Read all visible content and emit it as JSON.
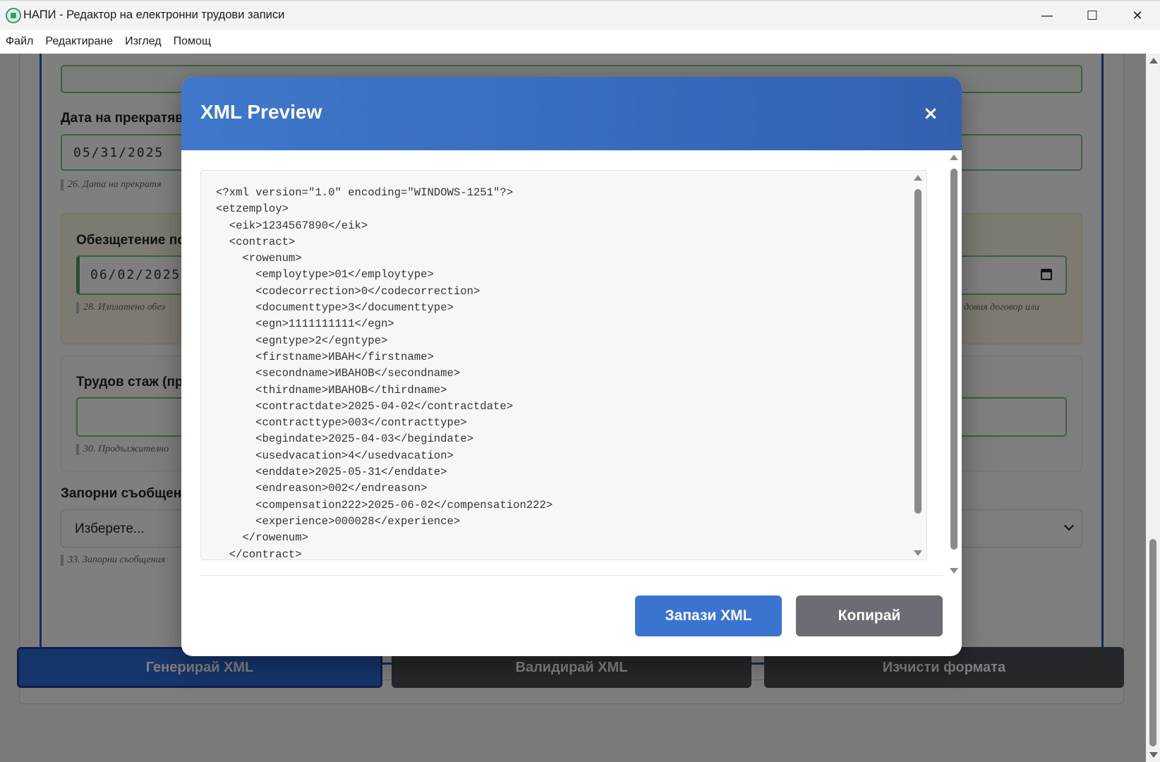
{
  "window": {
    "title": "НАПИ - Редактор на електронни трудови записи",
    "controls": {
      "minimize": "—",
      "maximize": "☐",
      "close": "✕"
    }
  },
  "menu": [
    "Файл",
    "Редактиране",
    "Изглед",
    "Помощ"
  ],
  "form": {
    "termination_date_label": "Дата на прекратяв",
    "termination_date_value": "05/31/2025",
    "termination_date_hint": "26. Дата на прекратя",
    "compensation_label": "Обезщетение по",
    "compensation_value": "06/02/2025",
    "compensation_hint": "28. Изплатено обез",
    "compensation_hint_right": "довия договор или",
    "experience_label": "Трудов стаж (пр",
    "experience_hint": "30. Продължително",
    "garnishment_label": "Запорни съобщени",
    "garnishment_value": "Изберете...",
    "garnishment_hint": "33. Запорни съобщения"
  },
  "bottom_buttons": {
    "generate": "Генерирай XML",
    "validate": "Валидирай XML",
    "clear": "Изчисти формата"
  },
  "modal": {
    "title": "XML Preview",
    "close": "×",
    "xml_lines": [
      "<?xml version=\"1.0\" encoding=\"WINDOWS-1251\"?>",
      "<etzemploy>",
      "  <eik>1234567890</eik>",
      "  <contract>",
      "    <rowenum>",
      "      <employtype>01</employtype>",
      "      <codecorrection>0</codecorrection>",
      "      <documenttype>3</documenttype>",
      "      <egn>1111111111</egn>",
      "      <egntype>2</egntype>",
      "      <firstname>ИВАН</firstname>",
      "      <secondname>ИВАНОВ</secondname>",
      "      <thirdname>ИВАНОВ</thirdname>",
      "      <contractdate>2025-04-02</contractdate>",
      "      <contracttype>003</contracttype>",
      "      <begindate>2025-04-03</begindate>",
      "      <usedvacation>4</usedvacation>",
      "      <enddate>2025-05-31</enddate>",
      "      <endreason>002</endreason>",
      "      <compensation222>2025-06-02</compensation222>",
      "      <experience>000028</experience>",
      "    </rowenum>",
      "  </contract>"
    ],
    "save_label": "Запази XML",
    "copy_label": "Копирай"
  }
}
